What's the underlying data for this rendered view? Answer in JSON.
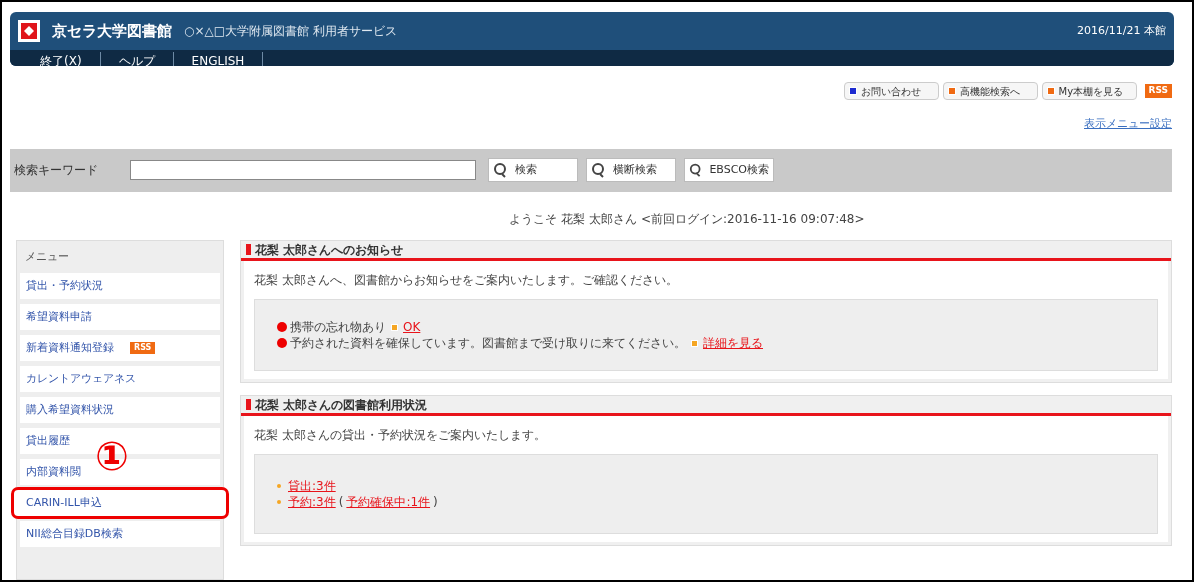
{
  "header": {
    "logo_title": "京セラ大学図書館",
    "subtitle": "○×△□大学附属図書館 利用者サービス",
    "date": "2016/11/21 本館",
    "nav": [
      "終了(X)",
      "ヘルプ",
      "ENGLISH"
    ]
  },
  "tool_buttons": [
    {
      "kind": "blue",
      "label": "お問い合わせ"
    },
    {
      "kind": "orange",
      "label": "高機能検索へ"
    },
    {
      "kind": "orange",
      "label": "My本棚を見る"
    },
    {
      "kind": "rss",
      "label": "RSS"
    }
  ],
  "menu_settings_link": "表示メニュー設定",
  "search": {
    "label": "検索キーワード",
    "buttons": [
      "検索",
      "横断検索",
      "EBSCO検索"
    ]
  },
  "welcome": "ようこそ 花梨 太郎さん <前回ログイン:2016-11-16 09:07:48>",
  "sidebar": {
    "title": "メニュー",
    "items": [
      {
        "label": "貸出・予約状況",
        "highlighted": false
      },
      {
        "label": "希望資料申請",
        "highlighted": false
      },
      {
        "label": "新着資料通知登録",
        "badge": "RSS",
        "highlighted": false
      },
      {
        "label": "カレントアウェアネス",
        "highlighted": false
      },
      {
        "label": "購入希望資料状況",
        "highlighted": false
      },
      {
        "label": "貸出履歴",
        "highlighted": false
      },
      {
        "label": "内部資料閲",
        "highlighted": false
      },
      {
        "label": "CARIN-ILL申込",
        "highlighted": true
      },
      {
        "label": "NII総合目録DB検索",
        "highlighted": false
      }
    ]
  },
  "annotation": "①",
  "panels": [
    {
      "kind": "notices",
      "title": "花梨 太郎さんへのお知らせ",
      "intro": "花梨 太郎さんへ、図書館からお知らせをご案内いたします。ご確認ください。",
      "items": [
        [
          {
            "kind": "text",
            "text": "携帯の忘れ物あり"
          },
          {
            "kind": "link",
            "text": "OK"
          }
        ],
        [
          {
            "kind": "text",
            "text": "予約された資料を確保しています。図書館まで受け取りに来てください。"
          },
          {
            "kind": "link",
            "text": "詳細を見る"
          }
        ]
      ]
    },
    {
      "kind": "status",
      "title": "花梨 太郎さんの図書館利用状況",
      "intro": "花梨 太郎さんの貸出・予約状況をご案内いたします。",
      "items": [
        [
          {
            "kind": "link",
            "text": "貸出:3件"
          }
        ],
        [
          {
            "kind": "link",
            "text": "予約:3件"
          },
          {
            "kind": "text",
            "text": "("
          },
          {
            "kind": "link",
            "text": "予約確保中:1件"
          },
          {
            "kind": "text",
            "text": ")"
          }
        ]
      ]
    }
  ]
}
